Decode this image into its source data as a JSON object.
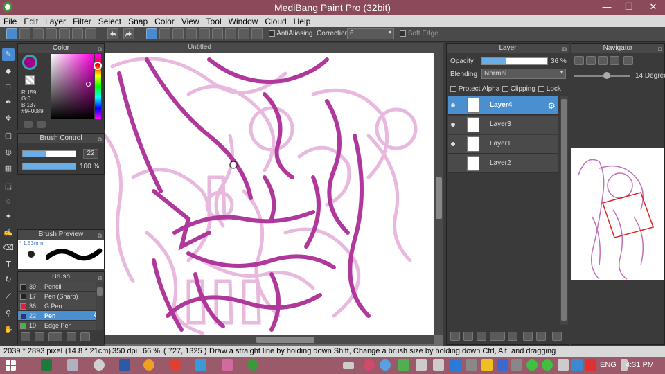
{
  "app": {
    "title": "MediBang Paint Pro (32bit)"
  },
  "window_controls": {
    "minimize": "—",
    "maximize": "❐",
    "close": "✕"
  },
  "menu": [
    "File",
    "Edit",
    "Layer",
    "Filter",
    "Select",
    "Snap",
    "Color",
    "View",
    "Tool",
    "Window",
    "Cloud",
    "Help"
  ],
  "toolbar": {
    "antialiasing_label": "AntiAliasing",
    "correction_label": "Correction",
    "correction_value": "6",
    "soft_edge_label": "Soft Edge"
  },
  "color_panel": {
    "title": "Color",
    "r": "R:159",
    "g": "G:0",
    "b": "B:137",
    "hex": "#9F0089",
    "current_color": "#9f0089"
  },
  "brush_control": {
    "title": "Brush Control",
    "size_value": "22",
    "opacity_value": "100 %",
    "opacity_fraction": 1.0
  },
  "brush_preview": {
    "title": "Brush Preview",
    "size_label": "* 1.63mm"
  },
  "brush_panel": {
    "title": "Brush",
    "items": [
      {
        "num": "39",
        "name": "Pencil",
        "color": "#222222"
      },
      {
        "num": "17",
        "name": "Pen (Sharp)",
        "color": "#222222"
      },
      {
        "num": "36",
        "name": "G Pen",
        "color": "#e0203a"
      },
      {
        "num": "22",
        "name": "Pen",
        "color": "#1a3a8a"
      },
      {
        "num": "10",
        "name": "Edge Pen",
        "color": "#30c030"
      }
    ],
    "selected_index": 3
  },
  "canvas": {
    "tab_title": "Untitled"
  },
  "layer_panel": {
    "title": "Layer",
    "opacity_label": "Opacity",
    "opacity_value": "36 %",
    "opacity_fraction": 0.36,
    "blending_label": "Blending",
    "blending_value": "Normal",
    "protect_alpha_label": "Protect Alpha",
    "clipping_label": "Clipping",
    "lock_label": "Lock",
    "layers": [
      {
        "name": "Layer4",
        "selected": true
      },
      {
        "name": "Layer3",
        "selected": false
      },
      {
        "name": "Layer1",
        "selected": false
      },
      {
        "name": "Layer2",
        "selected": false
      }
    ]
  },
  "navigator": {
    "title": "Navigator",
    "rotation_label": "14 Degree"
  },
  "status": {
    "image_size": "2039 * 2893 pixel",
    "physical_size": "(14.8 * 21cm)",
    "dpi": "350 dpi",
    "zoom": "66 %",
    "cursor": "( 727, 1325 )",
    "hint": "Draw a straight line by holding down Shift, Change a brush size by holding down Ctrl, Alt, and dragging"
  },
  "taskbar": {
    "language": "ENG",
    "time": "4:31 PM"
  },
  "colors": {
    "accent": "#4a90d0",
    "sketch": "#b0389c",
    "taskbar": "#9a5a6a",
    "titlebar": "#8a4a5a"
  }
}
